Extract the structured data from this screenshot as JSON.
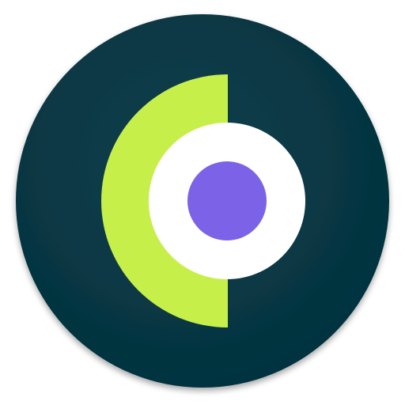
{
  "icon": {
    "name": "app-launcher-icon",
    "colors": {
      "background_ring": "#0b3f4c",
      "background_ring_inner": "#04313d",
      "half_moon": "#c7ef4a",
      "center_ring": "#ffffff",
      "center_dot": "#7b62e6",
      "shadow": "#000000"
    }
  }
}
